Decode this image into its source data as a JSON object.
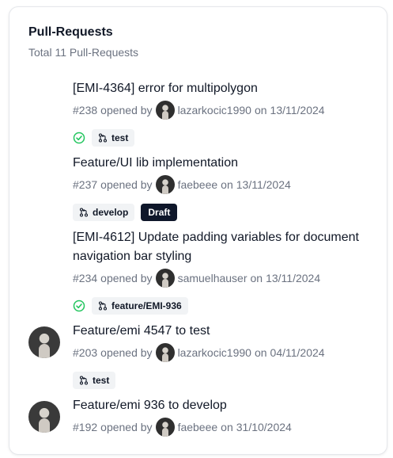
{
  "header": {
    "title": "Pull-Requests",
    "subtitle": "Total 11 Pull-Requests"
  },
  "pull_requests": [
    {
      "title": "[EMI-4364] error for multipolygon",
      "number": "#238",
      "opened_by_label": "opened by",
      "author": "lazarkocic1990",
      "on_label": "on",
      "date": "13/11/2024",
      "branch": "test",
      "checks_passed": true
    },
    {
      "title": "Feature/UI lib implementation",
      "number": "#237",
      "opened_by_label": "opened by",
      "author": "faebeee",
      "on_label": "on",
      "date": "13/11/2024",
      "branch": "develop",
      "draft_label": "Draft"
    },
    {
      "title": "[EMI-4612] Update padding variables for document navigation bar styling",
      "number": "#234",
      "opened_by_label": "opened by",
      "author": "samuelhauser",
      "on_label": "on",
      "date": "13/11/2024",
      "branch": "feature/EMI-936",
      "checks_passed": true
    },
    {
      "title": "Feature/emi 4547 to test",
      "number": "#203",
      "opened_by_label": "opened by",
      "author": "lazarkocic1990",
      "on_label": "on",
      "date": "04/11/2024",
      "branch": "test"
    },
    {
      "title": "Feature/emi 936 to develop",
      "number": "#192",
      "opened_by_label": "opened by",
      "author": "faebeee",
      "on_label": "on",
      "date": "31/10/2024"
    }
  ],
  "colors": {
    "check": "#22c55e",
    "draft_bg": "#0f172a",
    "badge_bg": "#f1f3f5"
  },
  "icons": {
    "check": "check-circle-icon",
    "branch": "git-branch-icon"
  }
}
